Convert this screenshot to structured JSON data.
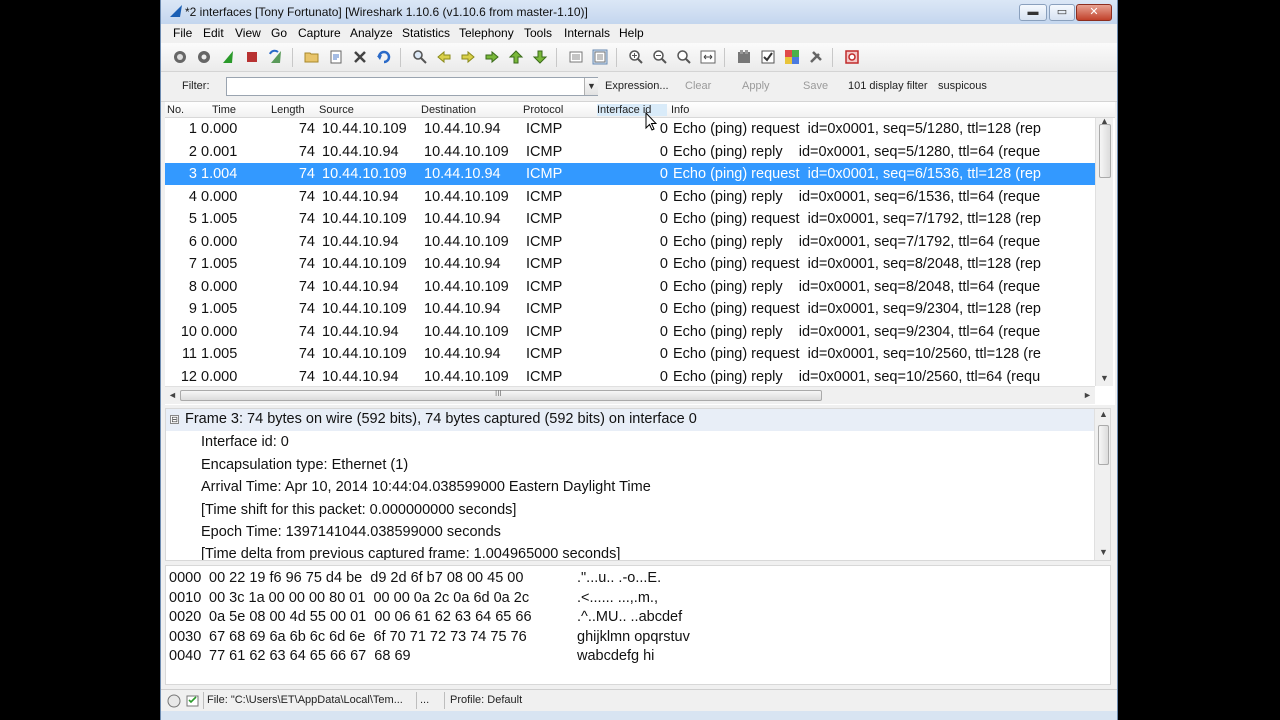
{
  "window": {
    "title": "*2 interfaces   [Tony Fortunato]   [Wireshark 1.10.6  (v1.10.6 from master-1.10)]",
    "minimize_glyph": "▬",
    "maximize_glyph": "▭",
    "close_glyph": "✕"
  },
  "menu": [
    "File",
    "Edit",
    "View",
    "Go",
    "Capture",
    "Analyze",
    "Statistics",
    "Telephony",
    "Tools",
    "Internals",
    "Help"
  ],
  "toolbar_icons": [
    "interfaces-icon",
    "options-icon",
    "start-capture-icon",
    "stop-capture-icon",
    "restart-capture-icon",
    "open-file-icon",
    "save-file-icon",
    "close-file-icon",
    "reload-icon",
    "find-packet-icon",
    "go-back-icon",
    "go-forward-icon",
    "go-to-packet-icon",
    "first-packet-icon",
    "last-packet-icon",
    "colorize-icon",
    "auto-scroll-icon",
    "zoom-in-icon",
    "zoom-out-icon",
    "normal-size-icon",
    "resize-columns-icon",
    "capture-filters-icon",
    "display-filters-icon",
    "coloring-rules-icon",
    "preferences-icon",
    "help-icon"
  ],
  "filter": {
    "label": "Filter:",
    "value": "",
    "dropdown_glyph": "▼",
    "expression": "Expression...",
    "clear": "Clear",
    "apply": "Apply",
    "save": "Save",
    "button_101": "101 display filter",
    "button_suspicious": "suspicous"
  },
  "packet_list": {
    "columns": [
      "No.",
      "Time",
      "Length",
      "Source",
      "Destination",
      "Protocol",
      "Interface id",
      "Info"
    ],
    "selected_index": 2,
    "rows": [
      {
        "no": "1",
        "time": "0.000",
        "length": "74",
        "source": "10.44.10.109",
        "destination": "10.44.10.94",
        "protocol": "ICMP",
        "iface": "0",
        "info": "Echo (ping) request  id=0x0001, seq=5/1280, ttl=128 (rep"
      },
      {
        "no": "2",
        "time": "0.001",
        "length": "74",
        "source": "10.44.10.94",
        "destination": "10.44.10.109",
        "protocol": "ICMP",
        "iface": "0",
        "info": "Echo (ping) reply    id=0x0001, seq=5/1280, ttl=64 (reque"
      },
      {
        "no": "3",
        "time": "1.004",
        "length": "74",
        "source": "10.44.10.109",
        "destination": "10.44.10.94",
        "protocol": "ICMP",
        "iface": "0",
        "info": "Echo (ping) request  id=0x0001, seq=6/1536, ttl=128 (rep"
      },
      {
        "no": "4",
        "time": "0.000",
        "length": "74",
        "source": "10.44.10.94",
        "destination": "10.44.10.109",
        "protocol": "ICMP",
        "iface": "0",
        "info": "Echo (ping) reply    id=0x0001, seq=6/1536, ttl=64 (reque"
      },
      {
        "no": "5",
        "time": "1.005",
        "length": "74",
        "source": "10.44.10.109",
        "destination": "10.44.10.94",
        "protocol": "ICMP",
        "iface": "0",
        "info": "Echo (ping) request  id=0x0001, seq=7/1792, ttl=128 (rep"
      },
      {
        "no": "6",
        "time": "0.000",
        "length": "74",
        "source": "10.44.10.94",
        "destination": "10.44.10.109",
        "protocol": "ICMP",
        "iface": "0",
        "info": "Echo (ping) reply    id=0x0001, seq=7/1792, ttl=64 (reque"
      },
      {
        "no": "7",
        "time": "1.005",
        "length": "74",
        "source": "10.44.10.109",
        "destination": "10.44.10.94",
        "protocol": "ICMP",
        "iface": "0",
        "info": "Echo (ping) request  id=0x0001, seq=8/2048, ttl=128 (rep"
      },
      {
        "no": "8",
        "time": "0.000",
        "length": "74",
        "source": "10.44.10.94",
        "destination": "10.44.10.109",
        "protocol": "ICMP",
        "iface": "0",
        "info": "Echo (ping) reply    id=0x0001, seq=8/2048, ttl=64 (reque"
      },
      {
        "no": "9",
        "time": "1.005",
        "length": "74",
        "source": "10.44.10.109",
        "destination": "10.44.10.94",
        "protocol": "ICMP",
        "iface": "0",
        "info": "Echo (ping) request  id=0x0001, seq=9/2304, ttl=128 (rep"
      },
      {
        "no": "10",
        "time": "0.000",
        "length": "74",
        "source": "10.44.10.94",
        "destination": "10.44.10.109",
        "protocol": "ICMP",
        "iface": "0",
        "info": "Echo (ping) reply    id=0x0001, seq=9/2304, ttl=64 (reque"
      },
      {
        "no": "11",
        "time": "1.005",
        "length": "74",
        "source": "10.44.10.109",
        "destination": "10.44.10.94",
        "protocol": "ICMP",
        "iface": "0",
        "info": "Echo (ping) request  id=0x0001, seq=10/2560, ttl=128 (re"
      },
      {
        "no": "12",
        "time": "0.000",
        "length": "74",
        "source": "10.44.10.94",
        "destination": "10.44.10.109",
        "protocol": "ICMP",
        "iface": "0",
        "info": "Echo (ping) reply    id=0x0001, seq=10/2560, ttl=64 (requ"
      }
    ],
    "scroll_marker": "III"
  },
  "details": {
    "expander_glyph": "⊟",
    "header": "Frame 3: 74 bytes on wire (592 bits), 74 bytes captured (592 bits) on interface 0",
    "lines": [
      "Interface id: 0",
      "Encapsulation type: Ethernet (1)",
      "Arrival Time: Apr 10, 2014 10:44:04.038599000 Eastern Daylight Time",
      "[Time shift for this packet: 0.000000000 seconds]",
      "Epoch Time: 1397141044.038599000 seconds",
      "[Time delta from previous captured frame: 1.004965000 seconds]"
    ]
  },
  "bytes": [
    {
      "offset": "0000",
      "hex": "00 22 19 f6 96 75 d4 be  d9 2d 6f b7 08 00 45 00",
      "ascii": ".\"...u.. .-o...E."
    },
    {
      "offset": "0010",
      "hex": "00 3c 1a 00 00 00 80 01  00 00 0a 2c 0a 6d 0a 2c",
      "ascii": ".<...... ...,.m.,"
    },
    {
      "offset": "0020",
      "hex": "0a 5e 08 00 4d 55 00 01  00 06 61 62 63 64 65 66",
      "ascii": ".^..MU.. ..abcdef"
    },
    {
      "offset": "0030",
      "hex": "67 68 69 6a 6b 6c 6d 6e  6f 70 71 72 73 74 75 76",
      "ascii": "ghijklmn opqrstuv"
    },
    {
      "offset": "0040",
      "hex": "77 61 62 63 64 65 66 67  68 69",
      "ascii": "wabcdefg hi"
    }
  ],
  "status": {
    "file": "File: \"C:\\Users\\ET\\AppData\\Local\\Tem...",
    "dots": "...",
    "profile": "Profile: Default"
  },
  "colors": {
    "selection": "#3399ff",
    "titlebar": "#c4d6ee"
  }
}
